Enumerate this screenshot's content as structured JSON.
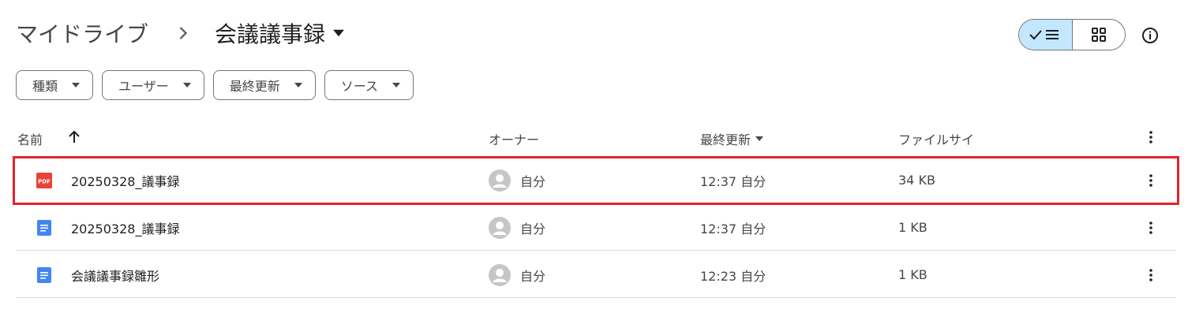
{
  "breadcrumb": {
    "root": "マイドライブ",
    "current": "会議議事録"
  },
  "view": {
    "mode": "list"
  },
  "filters": [
    {
      "label": "種類"
    },
    {
      "label": "ユーザー"
    },
    {
      "label": "最終更新"
    },
    {
      "label": "ソース"
    }
  ],
  "table": {
    "headers": {
      "name": "名前",
      "owner": "オーナー",
      "modified": "最終更新",
      "size": "ファイルサイ"
    },
    "rows": [
      {
        "type": "pdf",
        "icon_text": "PDF",
        "name": "20250328_議事録",
        "owner": "自分",
        "modified": "12:37 自分",
        "size": "34 KB",
        "highlighted": true
      },
      {
        "type": "doc",
        "name": "20250328_議事録",
        "owner": "自分",
        "modified": "12:37 自分",
        "size": "1 KB",
        "highlighted": false
      },
      {
        "type": "doc",
        "name": "会議議事録雛形",
        "owner": "自分",
        "modified": "12:23 自分",
        "size": "1 KB",
        "highlighted": false
      }
    ]
  },
  "colors": {
    "pdf_red": "#ea4335",
    "doc_blue": "#4285f4",
    "highlight_border": "#e0242a",
    "toggle_active_bg": "#c2e7ff"
  }
}
